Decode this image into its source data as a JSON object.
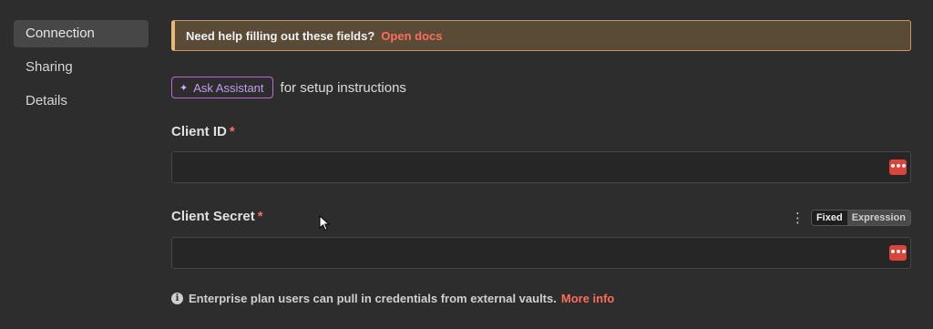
{
  "sidebar": {
    "items": [
      {
        "label": "Connection",
        "active": true
      },
      {
        "label": "Sharing",
        "active": false
      },
      {
        "label": "Details",
        "active": false
      }
    ]
  },
  "banner": {
    "text": "Need help filling out these fields?",
    "link": "Open docs"
  },
  "assistant": {
    "button_label": "Ask Assistant",
    "suffix": "for setup instructions"
  },
  "fields": {
    "client_id": {
      "label": "Client ID",
      "required_mark": "*",
      "value": ""
    },
    "client_secret": {
      "label": "Client Secret",
      "required_mark": "*",
      "value": ""
    }
  },
  "mode_toggle": {
    "fixed": "Fixed",
    "expression": "Expression",
    "selected": "Fixed"
  },
  "note": {
    "text": "Enterprise plan users can pull in credentials from external vaults.",
    "link": "More info"
  },
  "icons": {
    "assistant": "sparkle-icon",
    "password": "password-dots-icon",
    "info": "info-icon",
    "menu": "kebab-menu-icon"
  },
  "colors": {
    "accent": "#ff6d5a",
    "banner_bg": "#5a4b36",
    "banner_border": "#e8b877",
    "assistant": "#b86ad6"
  }
}
